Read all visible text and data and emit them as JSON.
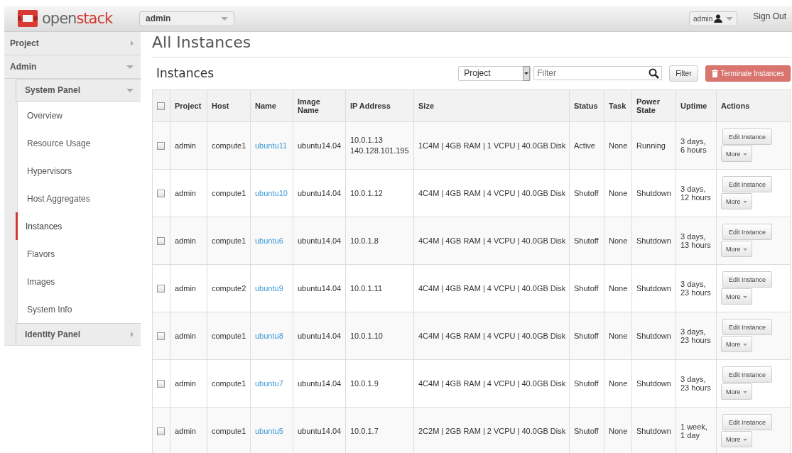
{
  "header": {
    "logo": {
      "part1": "open",
      "part2": "stack"
    },
    "project_select": "admin",
    "user_menu": "admin",
    "sign_out": "Sign Out"
  },
  "sidebar": {
    "items": [
      {
        "label": "Project",
        "expanded": false
      },
      {
        "label": "Admin",
        "expanded": true,
        "children": [
          {
            "label": "System Panel",
            "expanded": true,
            "children": [
              {
                "label": "Overview",
                "selected": false
              },
              {
                "label": "Resource Usage",
                "selected": false
              },
              {
                "label": "Hypervisors",
                "selected": false
              },
              {
                "label": "Host Aggregates",
                "selected": false
              },
              {
                "label": "Instances",
                "selected": true
              },
              {
                "label": "Flavors",
                "selected": false
              },
              {
                "label": "Images",
                "selected": false
              },
              {
                "label": "System Info",
                "selected": false
              }
            ]
          },
          {
            "label": "Identity Panel",
            "expanded": false
          }
        ]
      }
    ]
  },
  "page_title": "All Instances",
  "table_title": "Instances",
  "filter": {
    "field_select": "Project",
    "placeholder": "Filter",
    "button": "Filter",
    "terminate": "Terminate Instances"
  },
  "table": {
    "header_checked": false,
    "columns": [
      "Project",
      "Host",
      "Name",
      "Image Name",
      "IP Address",
      "Size",
      "Status",
      "Task",
      "Power State",
      "Uptime",
      "Actions"
    ],
    "rows": [
      {
        "checked": false,
        "project": "admin",
        "host": "compute1",
        "name": "ubuntu11",
        "image": "ubuntu14.04",
        "ip": [
          "10.0.1.13",
          "140.128.101.195"
        ],
        "size": "1C4M | 4GB RAM | 1 VCPU | 40.0GB Disk",
        "status": "Active",
        "task": "None",
        "power": "Running",
        "uptime": "3 days, 6 hours",
        "edit": "Edit Instance",
        "more": "More"
      },
      {
        "checked": false,
        "project": "admin",
        "host": "compute1",
        "name": "ubuntu10",
        "image": "ubuntu14.04",
        "ip": [
          "10.0.1.12"
        ],
        "size": "4C4M | 4GB RAM | 4 VCPU | 40.0GB Disk",
        "status": "Shutoff",
        "task": "None",
        "power": "Shutdown",
        "uptime": "3 days, 12 hours",
        "edit": "Edit Instance",
        "more": "More"
      },
      {
        "checked": false,
        "project": "admin",
        "host": "compute1",
        "name": "ubuntu6",
        "image": "ubuntu14.04",
        "ip": [
          "10.0.1.8"
        ],
        "size": "4C4M | 4GB RAM | 4 VCPU | 40.0GB Disk",
        "status": "Shutoff",
        "task": "None",
        "power": "Shutdown",
        "uptime": "3 days, 13 hours",
        "edit": "Edit Instance",
        "more": "More"
      },
      {
        "checked": false,
        "project": "admin",
        "host": "compute2",
        "name": "ubuntu9",
        "image": "ubuntu14.04",
        "ip": [
          "10.0.1.11"
        ],
        "size": "4C4M | 4GB RAM | 4 VCPU | 40.0GB Disk",
        "status": "Shutoff",
        "task": "None",
        "power": "Shutdown",
        "uptime": "3 days, 23 hours",
        "edit": "Edit Instance",
        "more": "More"
      },
      {
        "checked": false,
        "project": "admin",
        "host": "compute1",
        "name": "ubuntu8",
        "image": "ubuntu14.04",
        "ip": [
          "10.0.1.10"
        ],
        "size": "4C4M | 4GB RAM | 4 VCPU | 40.0GB Disk",
        "status": "Shutoff",
        "task": "None",
        "power": "Shutdown",
        "uptime": "3 days, 23 hours",
        "edit": "Edit Instance",
        "more": "More"
      },
      {
        "checked": false,
        "project": "admin",
        "host": "compute1",
        "name": "ubuntu7",
        "image": "ubuntu14.04",
        "ip": [
          "10.0.1.9"
        ],
        "size": "4C4M | 4GB RAM | 4 VCPU | 40.0GB Disk",
        "status": "Shutoff",
        "task": "None",
        "power": "Shutdown",
        "uptime": "3 days, 23 hours",
        "edit": "Edit Instance",
        "more": "More"
      },
      {
        "checked": false,
        "project": "admin",
        "host": "compute1",
        "name": "ubuntu5",
        "image": "ubuntu14.04",
        "ip": [
          "10.0.1.7"
        ],
        "size": "2C2M | 2GB RAM | 2 VCPU | 40.0GB Disk",
        "status": "Shutoff",
        "task": "None",
        "power": "Shutdown",
        "uptime": "1 week, 1 day",
        "edit": "Edit Instance",
        "more": "More"
      }
    ]
  }
}
